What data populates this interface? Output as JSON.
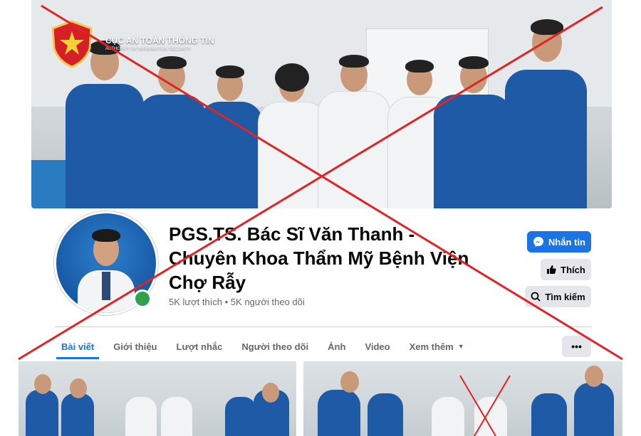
{
  "cover": {
    "org_name": "CỤC AN TOÀN THÔNG TIN",
    "org_subtitle": "AUTHORITY OF INFORMATION SECURITY"
  },
  "profile": {
    "name": "PGS.TS. Bác Sĩ Văn Thanh - Chuyên Khoa Thẩm Mỹ Bệnh Viện Chợ Rẫy",
    "stats": "5K lượt thích • 5K người theo dõi"
  },
  "actions": {
    "message_label": "Nhắn tin",
    "like_label": "Thích",
    "search_label": "Tìm kiếm"
  },
  "tabs": [
    {
      "label": "Bài viết",
      "active": true
    },
    {
      "label": "Giới thiệu"
    },
    {
      "label": "Lượt nhắc"
    },
    {
      "label": "Người theo dõi"
    },
    {
      "label": "Ảnh"
    },
    {
      "label": "Video"
    },
    {
      "label": "Xem thêm"
    }
  ],
  "more_label": "•••",
  "colors": {
    "accent": "#1b74e4",
    "warning_cross": "#e02424",
    "online": "#31a24c"
  },
  "icons": [
    "shield-star-icon",
    "messenger-icon",
    "thumbs-up-icon",
    "search-icon",
    "caret-down-icon"
  ]
}
